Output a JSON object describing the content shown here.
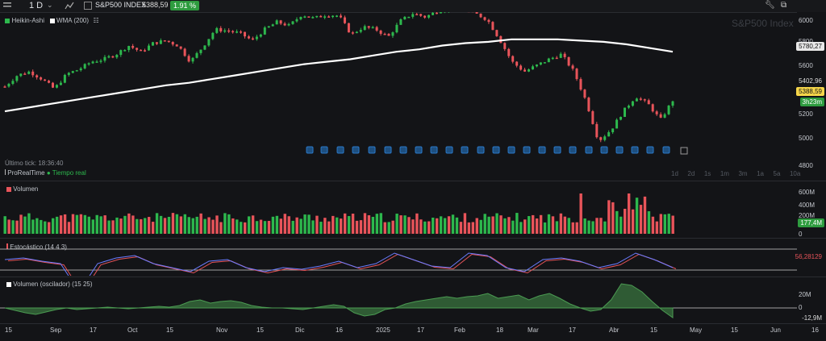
{
  "toolbar": {
    "timeframe": "1 D",
    "symbol": "S&P500 INDEX",
    "price": "5388,59",
    "change": "1.91 %"
  },
  "watermark": "S&P500 Index",
  "legend": {
    "series1": "Heikin-Ashi",
    "series2": "WMA (200)"
  },
  "last_tick": "Último tick: 18:36:40",
  "brand": "ProRealTime",
  "live": "Tiempo real",
  "timeframes": [
    "1d",
    "2d",
    "1s",
    "1m",
    "3m",
    "1a",
    "5a",
    "10a"
  ],
  "price_axis": [
    "6000",
    "5800",
    "5600",
    "5400",
    "5200",
    "5000",
    "4800"
  ],
  "price_tags": {
    "wma": "5780,27",
    "last_close": "5402,96",
    "current": "5388,59",
    "timer": "3h23m"
  },
  "panels": {
    "volume": {
      "title": "Volumen",
      "axis": [
        "600M",
        "400M",
        "200M",
        "0"
      ],
      "current": "177,4M"
    },
    "stoch": {
      "title": "Estocástico (14 4 3)",
      "current": "56,28129"
    },
    "volosc": {
      "title": "Volumen (oscilador) (15 25)",
      "axis": [
        "20M",
        "0"
      ],
      "current": "-12,9M"
    }
  },
  "time_axis": [
    "15",
    "Sep",
    "17",
    "Oct",
    "15",
    "Nov",
    "15",
    "Dic",
    "16",
    "2025",
    "17",
    "Feb",
    "18",
    "Mar",
    "17",
    "Abr",
    "15",
    "May",
    "15",
    "Jun",
    "16"
  ],
  "colors": {
    "up": "#2db84d",
    "down": "#e8545a",
    "wma": "#ffffff",
    "event": "#2a78c7"
  },
  "chart_data": {
    "type": "candlestick",
    "series": [
      {
        "name": "Heikin-Ashi",
        "close_path": [
          5500,
          5590,
          5620,
          5560,
          5480,
          5600,
          5640,
          5700,
          5720,
          5760,
          5830,
          5780,
          5850,
          5870,
          5830,
          5700,
          5820,
          5960,
          5950,
          5930,
          5870,
          5960,
          6020,
          5990,
          6080,
          6050,
          6080,
          6070,
          5920,
          5980,
          5960,
          5900,
          6030,
          6090,
          6060,
          6110,
          6130,
          6120,
          6090,
          6040,
          5880,
          5700,
          5620,
          5670,
          5720,
          5760,
          5620,
          5380,
          5060,
          5150,
          5300,
          5420,
          5360,
          5230,
          5388
        ]
      },
      {
        "name": "WMA (200)",
        "values": [
          5300,
          5330,
          5360,
          5390,
          5420,
          5450,
          5480,
          5510,
          5530,
          5560,
          5590,
          5620,
          5650,
          5680,
          5700,
          5720,
          5750,
          5780,
          5800,
          5830,
          5850,
          5860,
          5880,
          5880,
          5880,
          5870,
          5860,
          5840,
          5810,
          5780
        ]
      }
    ],
    "ylim": [
      4800,
      6100
    ]
  }
}
